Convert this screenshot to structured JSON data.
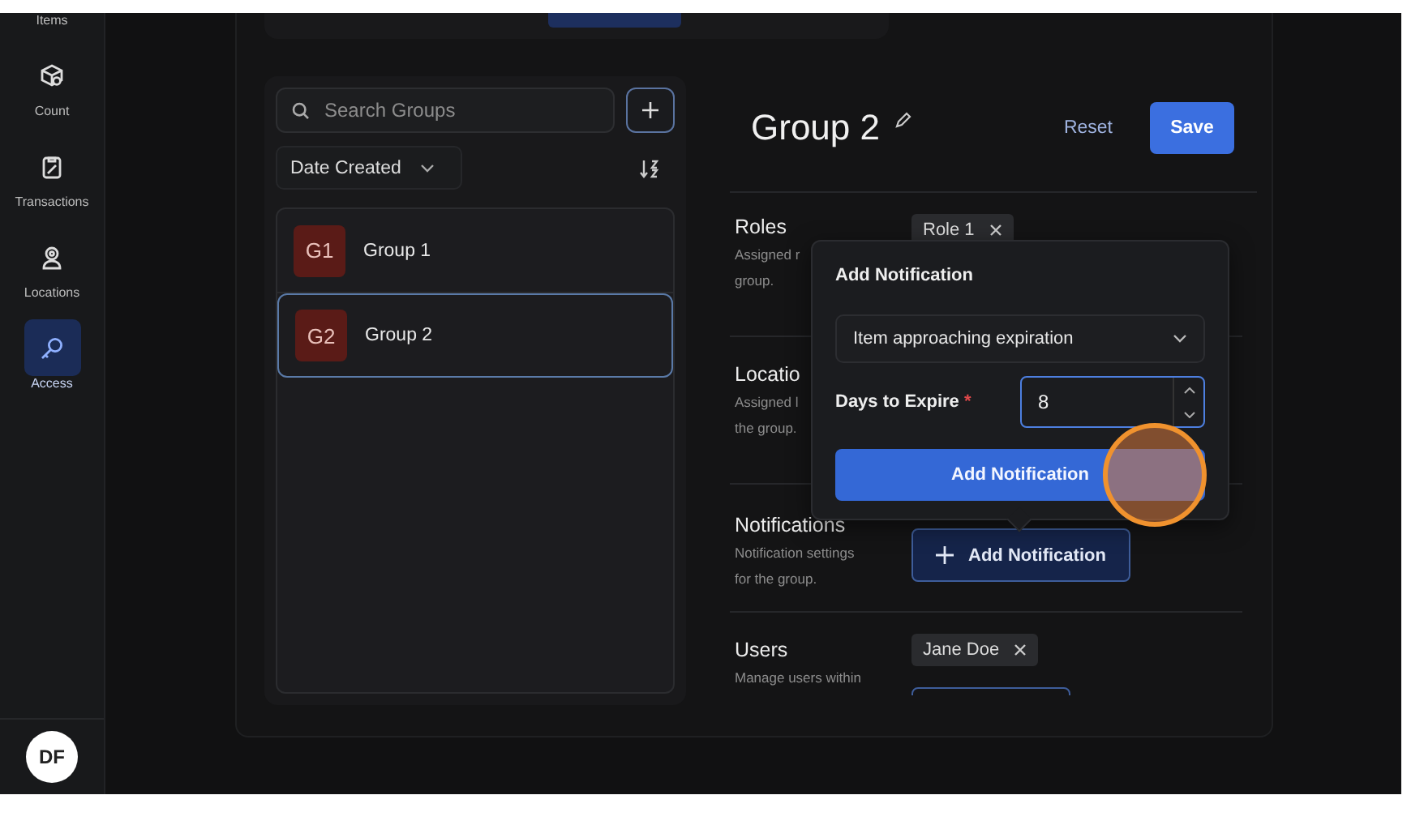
{
  "sidebar": {
    "items": [
      {
        "label": "Items",
        "kind": "label_only",
        "selected": false
      },
      {
        "label": "Count",
        "kind": "count",
        "selected": false
      },
      {
        "label": "Transactions",
        "kind": "transactions",
        "selected": false
      },
      {
        "label": "Locations",
        "kind": "locations",
        "selected": false
      },
      {
        "label": "Access",
        "kind": "access",
        "selected": true
      }
    ],
    "user": {
      "initials": "DF"
    }
  },
  "groups_panel": {
    "search": {
      "placeholder": "Search Groups"
    },
    "sort": {
      "value": "Date Created"
    },
    "groups": [
      {
        "badge": "G1",
        "name": "Group 1",
        "selected": false
      },
      {
        "badge": "G2",
        "name": "Group 2",
        "selected": true
      }
    ]
  },
  "detail": {
    "title": "Group 2",
    "reset": "Reset",
    "save": "Save",
    "sections": [
      {
        "kind": "roles",
        "title": "Roles",
        "description_lines": [
          "Assigned r",
          "group."
        ],
        "chips": [
          "Role 1"
        ]
      },
      {
        "kind": "locations",
        "title": "Locatio",
        "description_lines": [
          "Assigned l",
          "the group."
        ]
      },
      {
        "kind": "notifications",
        "title": "Notifications",
        "description_lines": [
          "Notification settings",
          "for the group."
        ],
        "button": "Add Notification"
      },
      {
        "kind": "users",
        "title": "Users",
        "description_lines": [
          "Manage users within"
        ],
        "chips": [
          "Jane Doe"
        ]
      }
    ]
  },
  "popup": {
    "title": "Add Notification",
    "type_select": {
      "value": "Item approaching expiration"
    },
    "days_field": {
      "label": "Days to Expire",
      "required_mark": "*",
      "value": "8"
    },
    "submit": "Add Notification"
  }
}
